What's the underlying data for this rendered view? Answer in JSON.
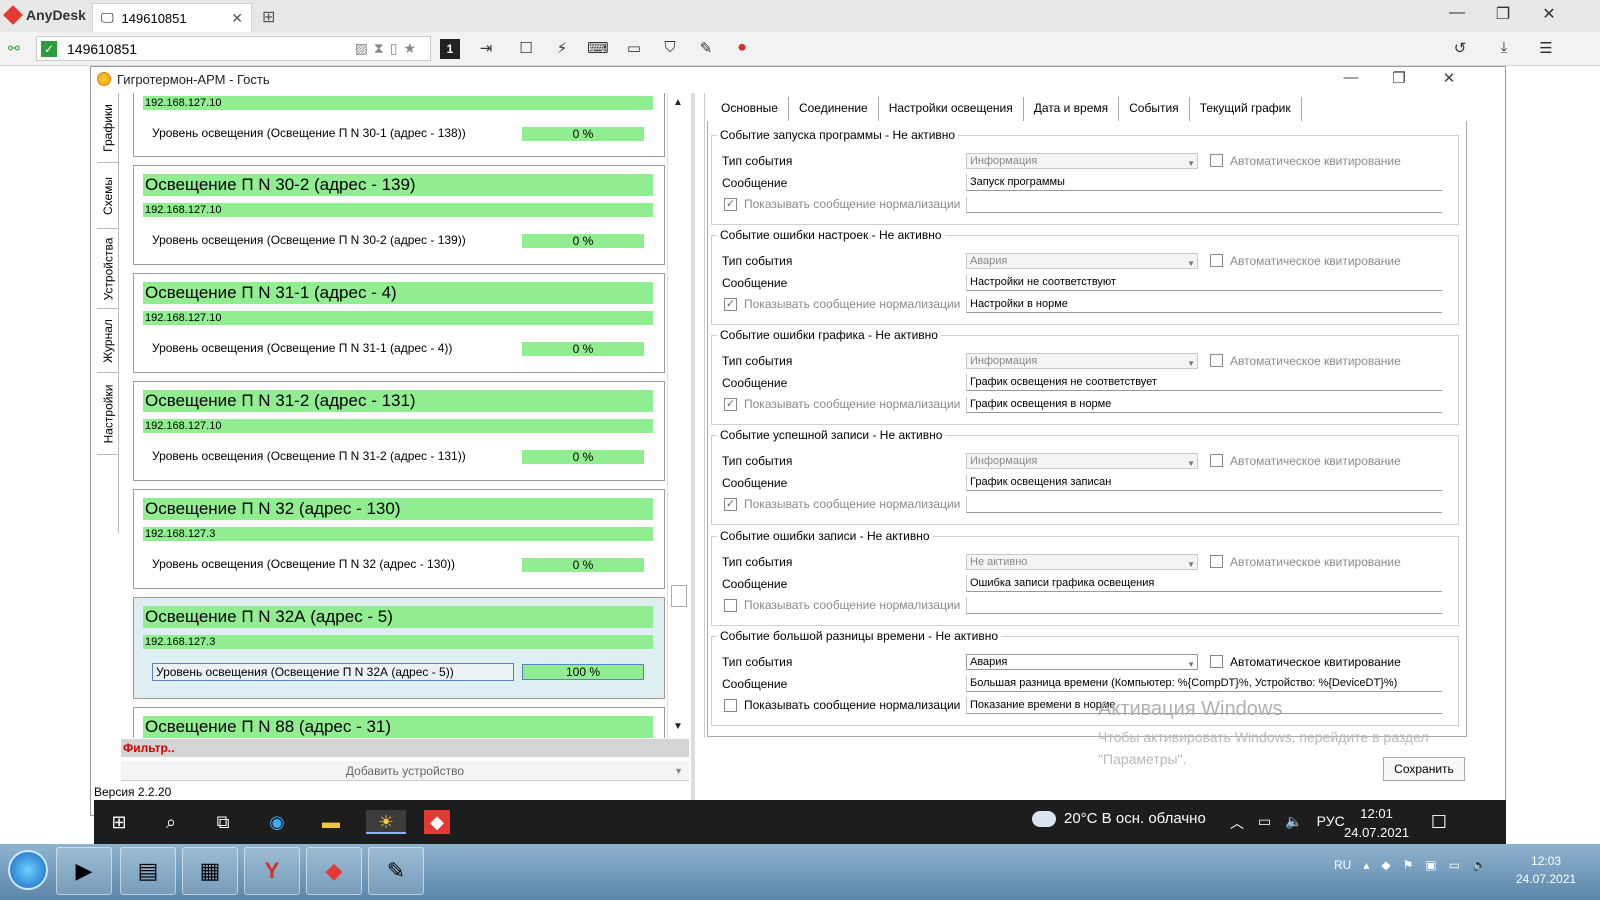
{
  "anydesk": {
    "brand": "AnyDesk",
    "tab_label": "149610851",
    "address": "149610851",
    "toolbar_display_index": "1"
  },
  "app": {
    "title": "Гигротермон-АРМ - Гость",
    "version": "Версия 2.2.20"
  },
  "side_nav": [
    "Графики",
    "Схемы",
    "Устройства",
    "Журнал",
    "Настройки"
  ],
  "devices": [
    {
      "title": "",
      "ip": "192.168.127.10",
      "param": "Уровень освещения (Освещение П N 30-1 (адрес - 138))",
      "value": "0 %"
    },
    {
      "title": "Освещение П N 30-2 (адрес - 139)",
      "ip": "192.168.127.10",
      "param": "Уровень освещения (Освещение П N 30-2 (адрес - 139))",
      "value": "0 %"
    },
    {
      "title": "Освещение П N 31-1 (адрес - 4)",
      "ip": "192.168.127.10",
      "param": "Уровень освещения (Освещение П N 31-1 (адрес - 4))",
      "value": "0 %"
    },
    {
      "title": "Освещение П N 31-2 (адрес - 131)",
      "ip": "192.168.127.10",
      "param": "Уровень освещения (Освещение П N 31-2 (адрес - 131))",
      "value": "0 %"
    },
    {
      "title": "Освещение П N 32 (адрес - 130)",
      "ip": "192.168.127.3",
      "param": "Уровень освещения (Освещение П N 32 (адрес - 130))",
      "value": "0 %"
    },
    {
      "title": "Освещение П N 32А (адрес - 5)",
      "ip": "192.168.127.3",
      "param": "Уровень освещения (Освещение П N 32А (адрес - 5))",
      "value": "100 %"
    },
    {
      "title": "Освещение П N 88 (адрес - 31)",
      "ip": "",
      "param": "",
      "value": ""
    }
  ],
  "filter_label": "Фильтр..",
  "add_device_label": "Добавить устройство",
  "tabs": [
    "Основные",
    "Соединение",
    "Настройки освещения",
    "Дата и время",
    "События",
    "Текущий график"
  ],
  "active_tab": "События",
  "labels": {
    "event_type": "Тип события",
    "message": "Сообщение",
    "show_normal": "Показывать сообщение нормализации",
    "auto_ack": "Автоматическое квитирование"
  },
  "event_groups": [
    {
      "title": "Событие запуска программы - Не активно",
      "type": "Информация",
      "message": "Запуск программы",
      "normal_message": "",
      "show_normal": true,
      "auto_ack": false,
      "enabled": false
    },
    {
      "title": "Событие ошибки настроек - Не активно",
      "type": "Авария",
      "message": "Настройки не соответствуют",
      "normal_message": "Настройки в норме",
      "show_normal": true,
      "auto_ack": false,
      "enabled": false
    },
    {
      "title": "Событие ошибки графика - Не активно",
      "type": "Информация",
      "message": "График освещения не соответствует",
      "normal_message": "График освещения в норме",
      "show_normal": true,
      "auto_ack": false,
      "enabled": false
    },
    {
      "title": "Событие успешной записи - Не активно",
      "type": "Информация",
      "message": "График освещения записан",
      "normal_message": "",
      "show_normal": true,
      "auto_ack": false,
      "enabled": false
    },
    {
      "title": "Событие ошибки записи - Не активно",
      "type": "Не активно",
      "message": "Ошибка записи графика освещения",
      "normal_message": "",
      "show_normal": false,
      "auto_ack": false,
      "enabled": false
    },
    {
      "title": "Событие большой разницы времени - Не активно",
      "type": "Авария",
      "message": "Большая разница времени (Компьютер: %{CompDT}%, Устройство: %{DeviceDT}%)",
      "normal_message": "Показание времени в норме",
      "show_normal": false,
      "auto_ack": false,
      "enabled": true
    }
  ],
  "save_label": "Сохранить",
  "watermark": {
    "title": "Активация Windows",
    "text": "Чтобы активировать Windows, перейдите в раздел \"Параметры\"."
  },
  "remote_taskbar": {
    "weather": "20°C  В осн. облачно",
    "lang": "РУС",
    "time": "12:01",
    "date": "24.07.2021"
  },
  "local_taskbar": {
    "lang": "RU",
    "time": "12:03",
    "date": "24.07.2021"
  },
  "colors": {
    "device_green": "#90ee90",
    "filter_red": "#d00000",
    "anydesk_red": "#e53935"
  }
}
